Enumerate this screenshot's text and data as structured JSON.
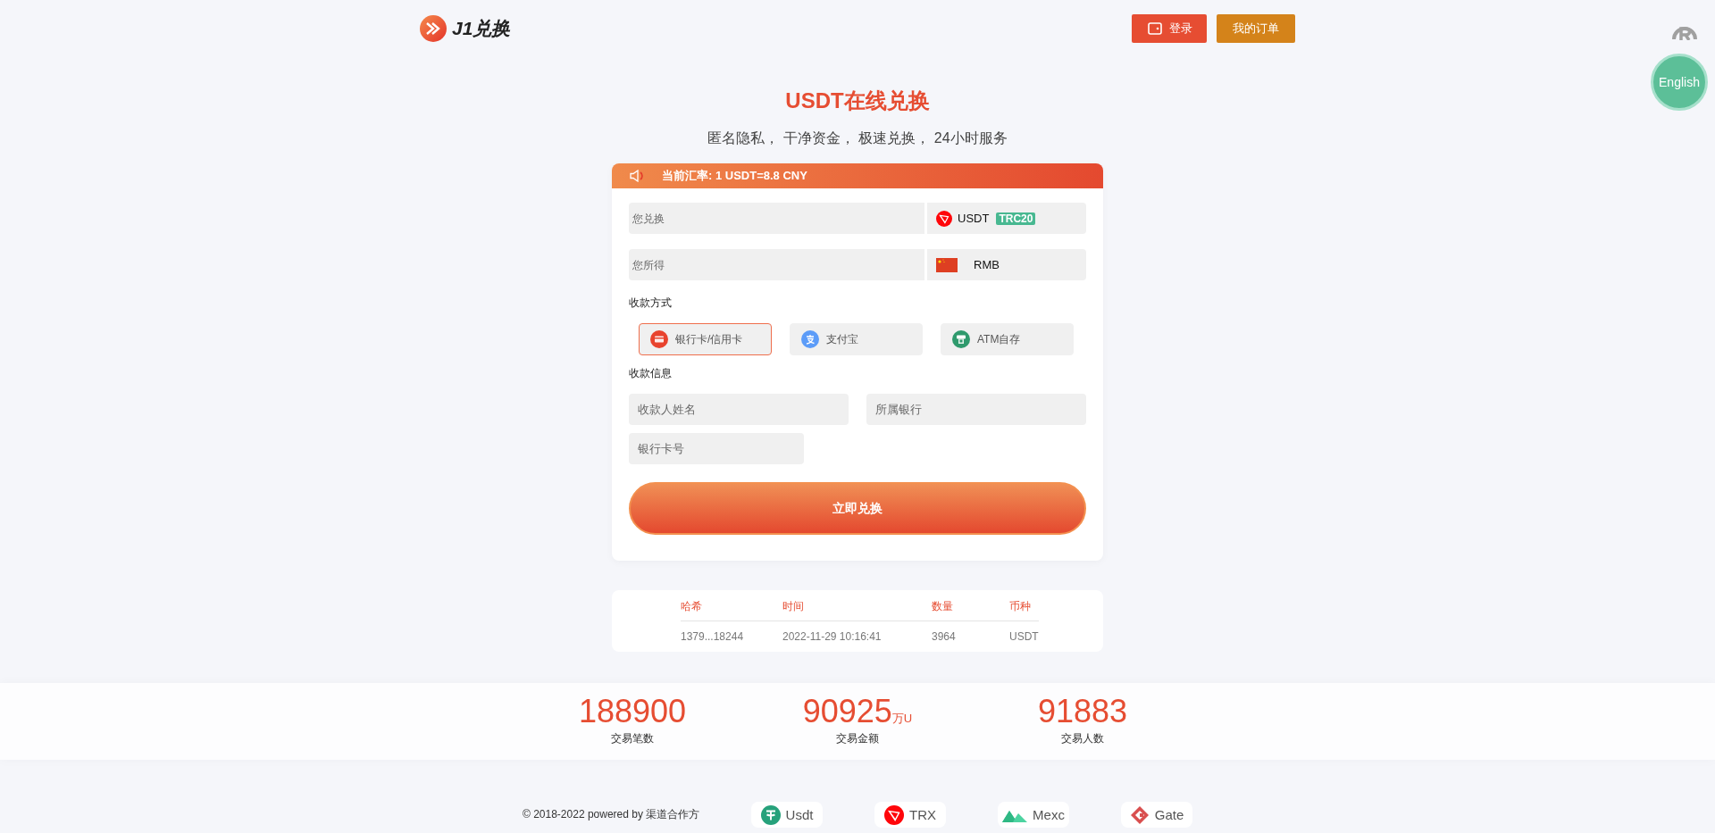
{
  "header": {
    "logo": "J1兑换",
    "buttons": [
      {
        "label": "登录",
        "kind": "login"
      },
      {
        "label": "我的订单",
        "kind": "orders"
      }
    ]
  },
  "language_button": "English",
  "hero": {
    "title": "USDT在线兑换",
    "subtitle": "匿名隐私， 干净资金， 极速兑换， 24小时服务"
  },
  "exchange_card": {
    "rate_notice": "当前汇率: 1 USDT=8.8 CNY",
    "fields": [
      {
        "placeholder": "您兑换",
        "currency": "USDT",
        "network": "TRC20",
        "kind": "usdt"
      },
      {
        "placeholder": "您所得",
        "currency": "RMB",
        "kind": "rmb"
      }
    ],
    "payment_label": "收款方式",
    "payment_methods": [
      {
        "label": "银行卡/信用卡",
        "kind": "bank",
        "selected": true
      },
      {
        "label": "支付宝",
        "kind": "alipay",
        "selected": false
      },
      {
        "label": "ATM自存",
        "kind": "atm",
        "selected": false
      }
    ],
    "info_label": "收款信息",
    "info_fields": [
      {
        "placeholder": "收款人姓名"
      },
      {
        "placeholder": "所属银行"
      },
      {
        "placeholder": "银行卡号"
      }
    ],
    "submit": "立即兑换"
  },
  "transactions": {
    "columns": [
      "哈希",
      "时间",
      "数量",
      "币种"
    ],
    "rows": [
      [
        "1379...18244",
        "2022-11-29 10:16:41",
        "3964",
        "USDT"
      ]
    ]
  },
  "stats": [
    {
      "value": "188900",
      "label": "交易笔数"
    },
    {
      "value": "90925",
      "unit": "万U",
      "label": "交易金额"
    },
    {
      "value": "91883",
      "label": "交易人数"
    }
  ],
  "footer": {
    "copyright": "© 2018-2022 powered by 渠道合作方",
    "partners": [
      {
        "label": "Usdt",
        "kind": "tether"
      },
      {
        "label": "TRX",
        "kind": "tron"
      },
      {
        "label": "Mexc",
        "kind": "mexc"
      },
      {
        "label": "Gate",
        "kind": "gate"
      }
    ]
  }
}
